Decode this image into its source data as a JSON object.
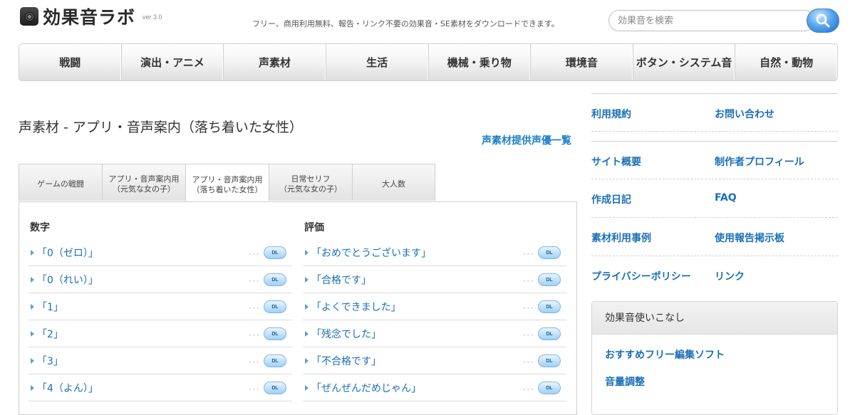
{
  "header": {
    "logo_text": "効果音ラボ",
    "version": "ver 3.0",
    "tagline": "フリー、商用利用無料、報告・リンク不要の効果音・SE素材をダウンロードできます。",
    "search_placeholder": "効果音を検索"
  },
  "nav": {
    "items": [
      "戦闘",
      "演出・アニメ",
      "声素材",
      "生活",
      "機械・乗り物",
      "環境音",
      "ボタン・システム音",
      "自然・動物"
    ]
  },
  "main": {
    "title": "声素材 - アプリ・音声案内（落ち着いた女性）",
    "voice_list_link": "声素材提供声優一覧",
    "tabs": [
      {
        "line1": "ゲームの戦闘",
        "line2": ""
      },
      {
        "line1": "アプリ・音声案内用",
        "line2": "（元気な女の子）"
      },
      {
        "line1": "アプリ・音声案内用",
        "line2": "（落ち着いた女性）"
      },
      {
        "line1": "日常セリフ",
        "line2": "（元気な女の子）"
      },
      {
        "line1": "大人数",
        "line2": ""
      }
    ],
    "active_tab": 2,
    "left_column": {
      "heading": "数字",
      "rows": [
        "「0（ゼロ）」",
        "「0（れい）」",
        "「1」",
        "「2」",
        "「3」",
        "「4（よん）」"
      ]
    },
    "right_column": {
      "heading": "評価",
      "rows": [
        "「おめでとうございます」",
        "「合格です」",
        "「よくできました」",
        "「残念でした」",
        "「不合格です」",
        "「ぜんぜんだめじゃん」"
      ]
    },
    "dl_label": "DL",
    "dots": "･･･"
  },
  "sidebar": {
    "links": [
      [
        "利用規約",
        "お問い合わせ"
      ],
      [
        "サイト概要",
        "制作者プロフィール"
      ],
      [
        "作成日記",
        "FAQ"
      ],
      [
        "素材利用事例",
        "使用報告掲示板"
      ],
      [
        "プライバシーポリシー",
        "リンク"
      ]
    ],
    "box": {
      "heading": "効果音使いこなし",
      "links": [
        "おすすめフリー編集ソフト",
        "音量調整"
      ]
    }
  },
  "colors": {
    "link": "#1a6fb8",
    "accent_link": "#1a7fc9",
    "dl_button": "#9fd0f7"
  }
}
